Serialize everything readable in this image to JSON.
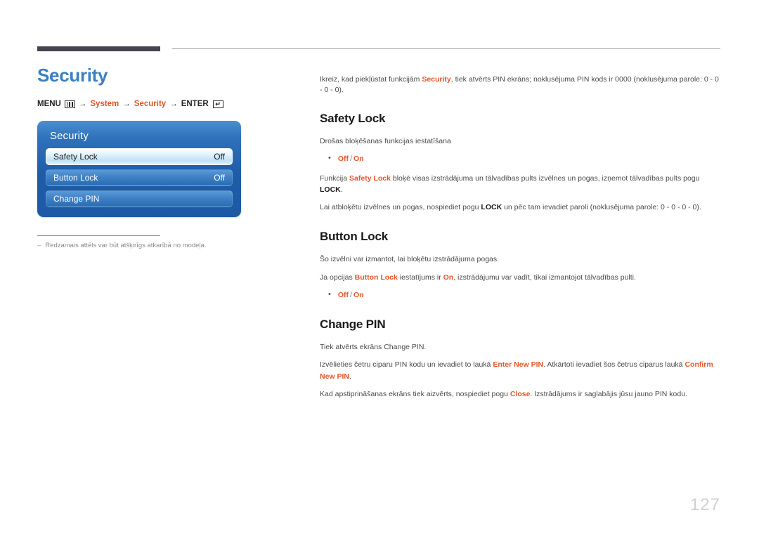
{
  "header": {
    "rule_color_dark": "#46424f",
    "rule_color_thin": "#9b9b9b"
  },
  "page_title": "Security",
  "breadcrumb": {
    "menu_label": "MENU",
    "menu_icon": "menu-bars-icon",
    "arrow": "→",
    "step1": "System",
    "step2": "Security",
    "enter_label": "ENTER",
    "enter_icon": "enter-return-icon",
    "enter_glyph": "↵",
    "accent_color": "#e8542a"
  },
  "osd": {
    "title": "Security",
    "rows": [
      {
        "label": "Safety Lock",
        "value": "Off",
        "selected": true
      },
      {
        "label": "Button Lock",
        "value": "Off",
        "selected": false
      },
      {
        "label": "Change PIN",
        "value": "",
        "selected": false
      }
    ]
  },
  "footnote": {
    "dash": "–",
    "text": "Redzamais attēls var būt atšķirīgs atkarībā no modeļa."
  },
  "intro": {
    "part1": "Ikreiz, kad piekļūstat funkcijām ",
    "kw": "Security",
    "part2": ", tiek atvērts PIN ekrāns; noklusējuma PIN kods ir 0000 (noklusējuma parole: 0 - 0 - 0 - 0)."
  },
  "sections": [
    {
      "heading": "Safety Lock",
      "desc": "Drošas bloķēšanas funkcijas iestatīšana",
      "options": {
        "off": "Off",
        "slash": "/",
        "on": "On"
      },
      "p1_a": "Funkcija ",
      "p1_kw": "Safety Lock",
      "p1_b": " bloķē visas izstrādājuma un tālvadības pults izvēlnes un pogas, izņemot tālvadības pults pogu ",
      "p1_bk": "LOCK",
      "p1_c": ".",
      "p2_a": "Lai atbloķētu izvēlnes un pogas, nospiediet pogu ",
      "p2_bk": "LOCK",
      "p2_b": " un pēc tam ievadiet paroli (noklusējuma parole: 0 - 0 - 0 - 0)."
    },
    {
      "heading": "Button Lock",
      "desc": "Šo izvēlni var izmantot, lai bloķētu izstrādājuma pogas.",
      "p1_a": "Ja opcijas ",
      "p1_kw": "Button Lock",
      "p1_b": " iestatījums ir ",
      "p1_kw2": "On",
      "p1_c": ", izstrādājumu var vadīt, tikai izmantojot tālvadības pulti.",
      "options": {
        "off": "Off",
        "slash": "/",
        "on": "On"
      }
    },
    {
      "heading": "Change PIN",
      "desc": "Tiek atvērts ekrāns Change PIN.",
      "p1_a": "Izvēlieties četru ciparu PIN kodu un ievadiet to laukā ",
      "p1_kw": "Enter New PIN",
      "p1_b": ". Atkārtoti ievadiet šos četrus ciparus laukā ",
      "p1_kw2": "Confirm New PIN",
      "p1_c": ".",
      "p2_a": "Kad apstiprināšanas ekrāns tiek aizvērts, nospiediet pogu ",
      "p2_kw": "Close",
      "p2_b": ". Izstrādājums ir saglabājis jūsu jauno PIN kodu."
    }
  ],
  "page_number": "127"
}
